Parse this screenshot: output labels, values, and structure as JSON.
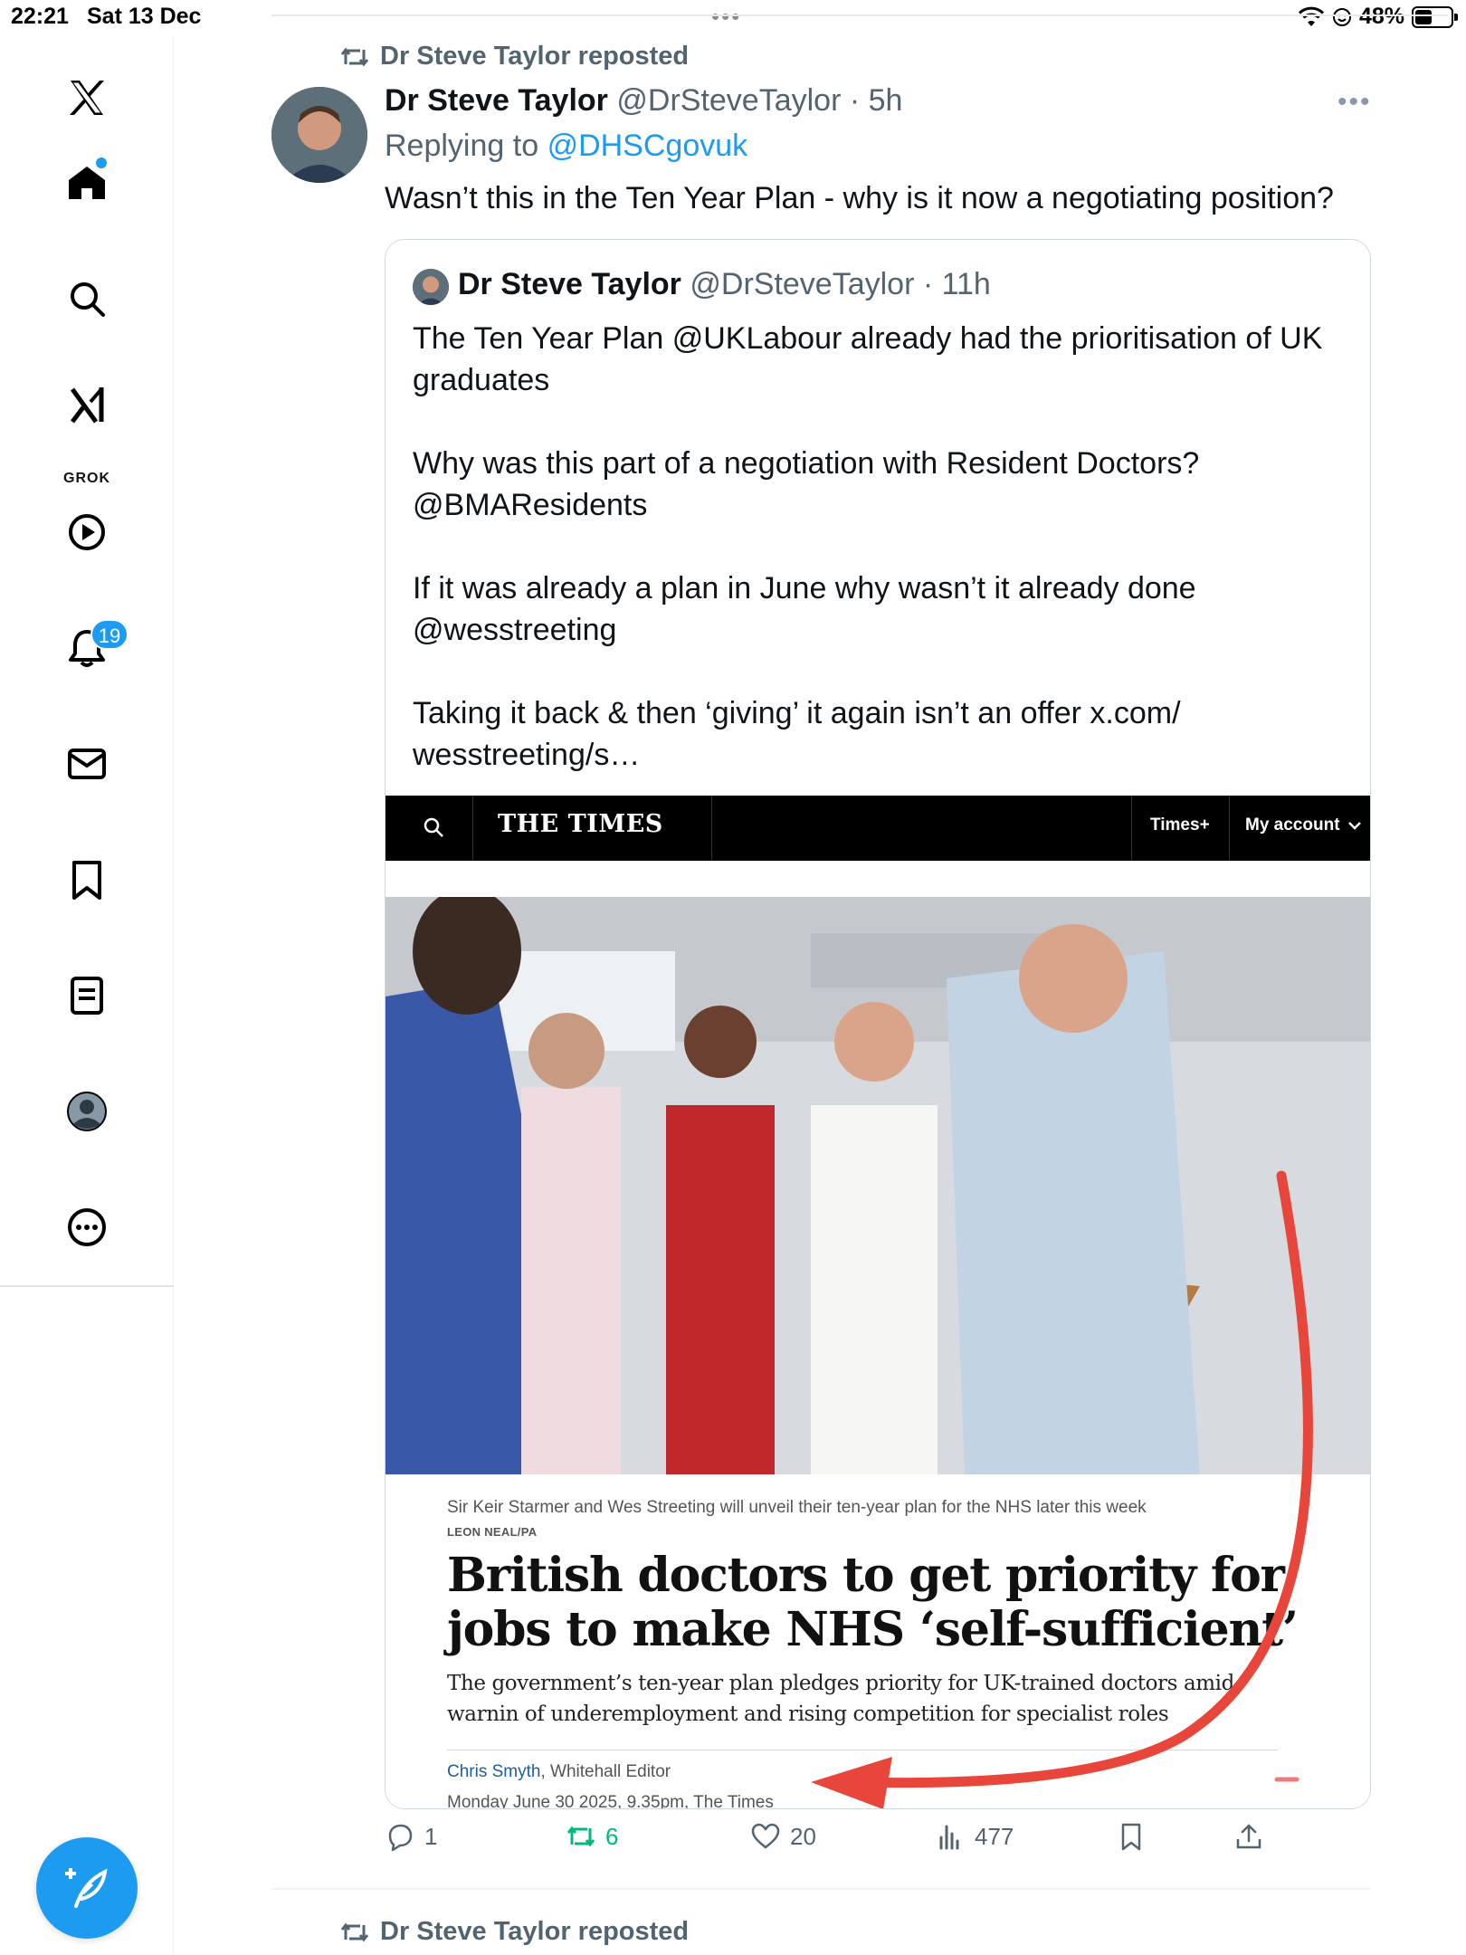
{
  "status_bar": {
    "time": "22:21",
    "date": "Sat 13 Dec",
    "battery_text": "48%",
    "battery_level": 0.48
  },
  "sidebar": {
    "grok_label": "GROK",
    "notifications_badge": "19",
    "items": [
      {
        "icon": "x-logo-icon"
      },
      {
        "icon": "home-icon"
      },
      {
        "icon": "search-icon"
      },
      {
        "icon": "grok-icon"
      },
      {
        "icon": "video-play-icon"
      },
      {
        "icon": "bell-icon"
      },
      {
        "icon": "mail-icon"
      },
      {
        "icon": "bookmark-icon"
      },
      {
        "icon": "lists-icon"
      },
      {
        "icon": "profile-icon"
      },
      {
        "icon": "more-icon"
      }
    ]
  },
  "tweet": {
    "repost_label": "Dr Steve Taylor reposted",
    "author_name": "Dr Steve Taylor",
    "author_handle": "@DrSteveTaylor",
    "time": "5h",
    "replying_prefix": "Replying to",
    "replying_to": "@DHSCgovuk",
    "text": "Wasn’t this in the Ten Year Plan - why is it now a negotiating position?",
    "quote": {
      "author_name": "Dr Steve Taylor",
      "author_handle": "@DrSteveTaylor",
      "time": "11h",
      "paragraphs": [
        "The Ten Year Plan @UKLabour already had the prioritisation of UK graduates",
        "Why was this part of a negotiation with Resident Doctors? @BMAResidents",
        "If it was already a plan in June why wasn’t it already done @wesstreeting",
        "Taking it back & then ‘giving’ it again isn’t an offer x.com/ wesstreeting/s…"
      ],
      "article": {
        "logo": "THE TIMES",
        "nav_timesplus": "Times+",
        "nav_account": "My account",
        "caption": "Sir Keir Starmer and Wes Streeting will unveil their ten-year plan for the NHS later this week",
        "photo_credit": "LEON NEAL/PA",
        "headline": "British doctors to get priority for jobs to make NHS ‘self-sufficient’",
        "standfirst": "The government’s ten-year plan pledges priority for UK-trained doctors amid warnin of underemployment and rising competition for specialist roles",
        "byline_name": "Chris Smyth",
        "byline_role": ", Whitehall Editor",
        "dateline": "Monday June 30 2025, 9.35pm, The Times"
      }
    },
    "actions": {
      "replies": "1",
      "reposts": "6",
      "likes": "20",
      "views": "477"
    }
  },
  "next_tweet": {
    "repost_label": "Dr Steve Taylor reposted"
  },
  "colors": {
    "accent": "#1d9bf0",
    "repost_green": "#00ba7c",
    "secondary_text": "#536471",
    "annotation_red": "#e8463a"
  }
}
